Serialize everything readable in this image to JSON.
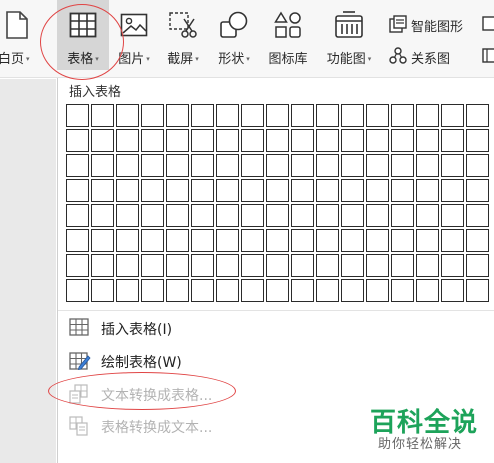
{
  "ribbon": {
    "partial_label": "白页",
    "table_label": "表格",
    "picture_label": "图片",
    "screenshot_label": "截屏",
    "shapes_label": "形状",
    "icons_label": "图标库",
    "function_chart_label": "功能图",
    "smart_graphic_label": "智能图形",
    "relation_chart_label": "关系图",
    "dropdown_arrow": "▾"
  },
  "dropdown": {
    "insert_title": "插入表格",
    "grid": {
      "columns": 17,
      "rows": 8
    },
    "menu": [
      {
        "label": "插入表格(I)",
        "icon": "insert-table-icon",
        "enabled": true
      },
      {
        "label": "绘制表格(W)",
        "icon": "draw-table-icon",
        "enabled": true
      },
      {
        "label": "文本转换成表格...",
        "icon": "text-to-table-icon",
        "enabled": false
      },
      {
        "label": "表格转换成文本...",
        "icon": "table-to-text-icon",
        "enabled": false
      }
    ]
  },
  "watermark": {
    "logo": "百科全说",
    "subtitle": "助你轻松解决"
  },
  "colors": {
    "annotation": "#e04444",
    "watermark_green": "#1da35a",
    "selected_button_bg": "#d6d6d6",
    "disabled_text": "#b3b3b3"
  }
}
